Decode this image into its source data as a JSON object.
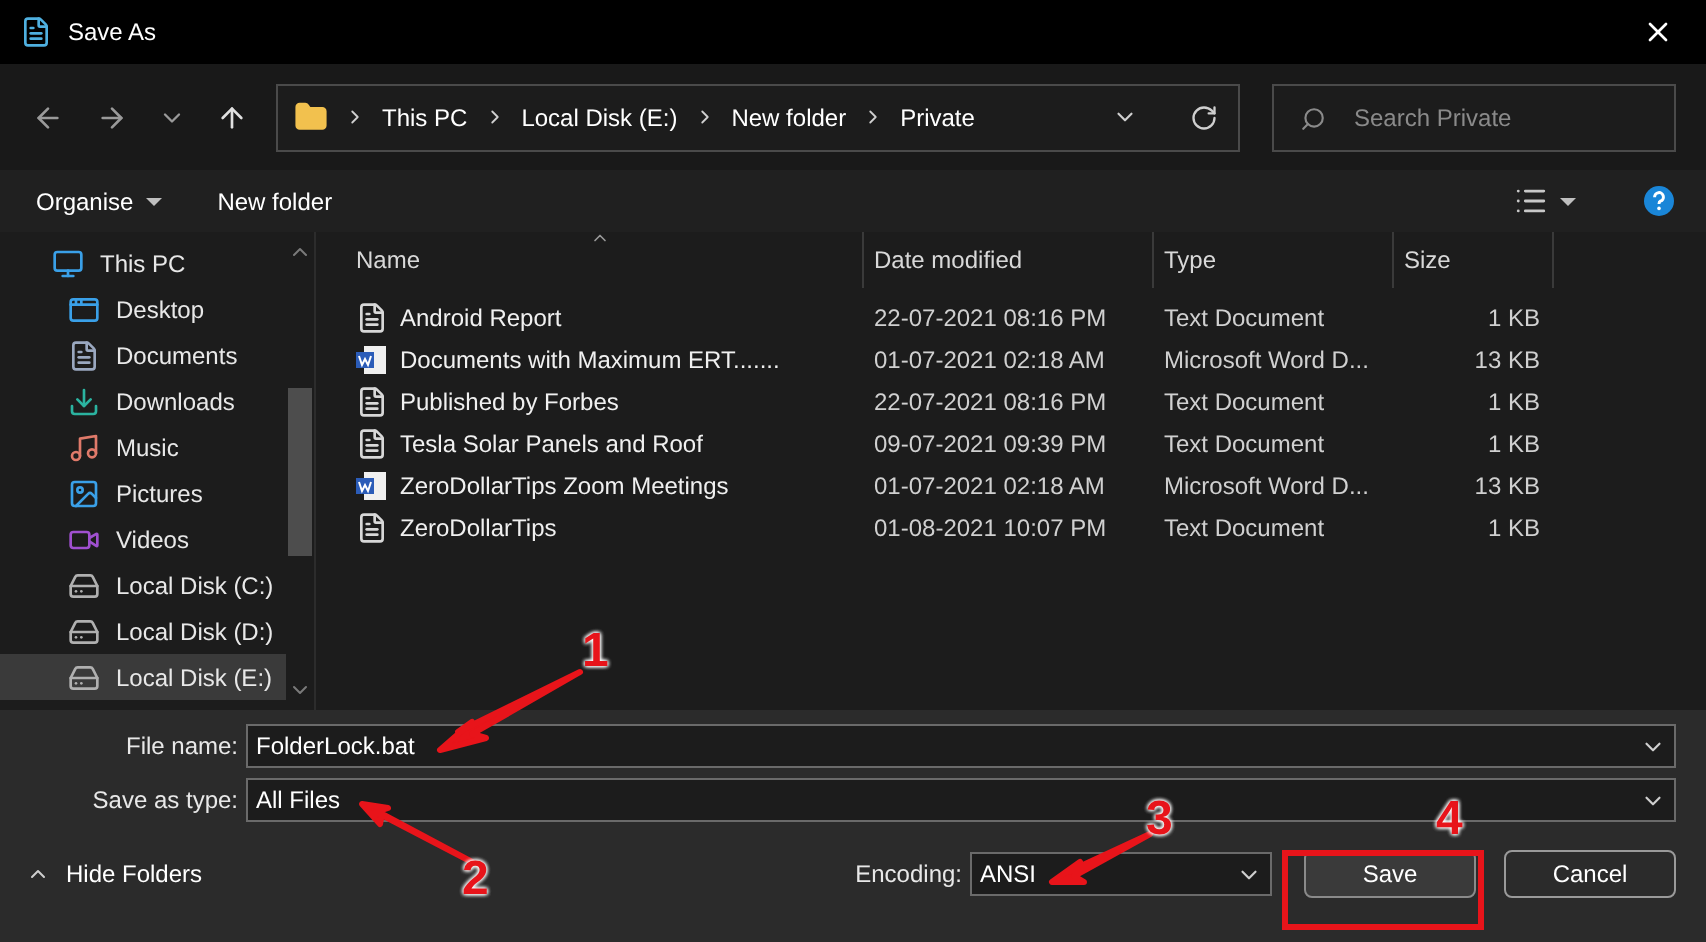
{
  "window": {
    "title": "Save As"
  },
  "address_bar": {
    "crumbs": [
      "This PC",
      "Local Disk (E:)",
      "New folder",
      "Private"
    ]
  },
  "search": {
    "placeholder": "Search Private"
  },
  "toolbar": {
    "organise": "Organise",
    "new_folder": "New folder"
  },
  "sidebar": {
    "items": [
      {
        "label": "This PC",
        "kind": "pc",
        "selected": false,
        "children": [
          {
            "label": "Desktop",
            "kind": "desktop",
            "selected": false
          },
          {
            "label": "Documents",
            "kind": "documents",
            "selected": false
          },
          {
            "label": "Downloads",
            "kind": "downloads",
            "selected": false
          },
          {
            "label": "Music",
            "kind": "music",
            "selected": false
          },
          {
            "label": "Pictures",
            "kind": "pictures",
            "selected": false
          },
          {
            "label": "Videos",
            "kind": "videos",
            "selected": false
          },
          {
            "label": "Local Disk (C:)",
            "kind": "system-drive",
            "selected": false
          },
          {
            "label": "Local Disk (D:)",
            "kind": "drive",
            "selected": false
          },
          {
            "label": "Local Disk (E:)",
            "kind": "drive",
            "selected": true
          }
        ]
      }
    ]
  },
  "table": {
    "columns": [
      "Name",
      "Date modified",
      "Type",
      "Size"
    ],
    "rows": [
      {
        "kind": "text",
        "name": "Android Report",
        "date": "22-07-2021 08:16 PM",
        "type": "Text Document",
        "size": "1 KB"
      },
      {
        "kind": "word",
        "name": "Documents with Maximum ERT.......",
        "date": "01-07-2021 02:18 AM",
        "type": "Microsoft Word D...",
        "size": "13 KB"
      },
      {
        "kind": "text",
        "name": "Published by Forbes",
        "date": "22-07-2021 08:16 PM",
        "type": "Text Document",
        "size": "1 KB"
      },
      {
        "kind": "text",
        "name": "Tesla Solar Panels and Roof",
        "date": "09-07-2021 09:39 PM",
        "type": "Text Document",
        "size": "1 KB"
      },
      {
        "kind": "word",
        "name": "ZeroDollarTips Zoom Meetings",
        "date": "01-07-2021 02:18 AM",
        "type": "Microsoft Word D...",
        "size": "13 KB"
      },
      {
        "kind": "text",
        "name": "ZeroDollarTips",
        "date": "01-08-2021 10:07 PM",
        "type": "Text Document",
        "size": "1 KB"
      }
    ]
  },
  "form": {
    "file_name": {
      "label": "File name:",
      "value": "FolderLock.bat"
    },
    "save_as_type": {
      "label": "Save as type:",
      "value": "All Files"
    },
    "encoding": {
      "label": "Encoding:",
      "value": "ANSI"
    }
  },
  "hide_folders": "Hide Folders",
  "buttons": [
    "Save",
    "Cancel"
  ],
  "annotations": [
    "1",
    "2",
    "3",
    "4"
  ]
}
